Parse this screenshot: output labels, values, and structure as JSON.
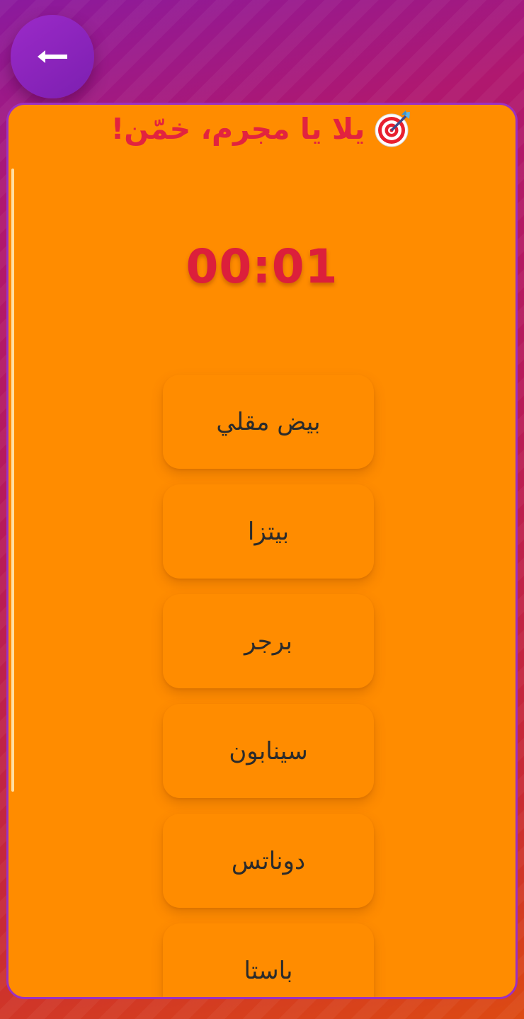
{
  "header": {
    "back_icon": "arrow-left-icon",
    "title": "يلا يا مجرم، خمّن!",
    "title_icon": "target-dart-icon"
  },
  "timer": {
    "value": "00:01"
  },
  "options": [
    {
      "label": "بيض مقلي"
    },
    {
      "label": "بيتزا"
    },
    {
      "label": "برجر"
    },
    {
      "label": "سينابون"
    },
    {
      "label": "دوناتس"
    },
    {
      "label": "باستا"
    }
  ],
  "colors": {
    "card_background": "#ff8c00",
    "card_border": "#9b30c2",
    "title_color": "#e2233f",
    "timer_color": "#dc1f3b",
    "back_button": "#8a24be"
  }
}
